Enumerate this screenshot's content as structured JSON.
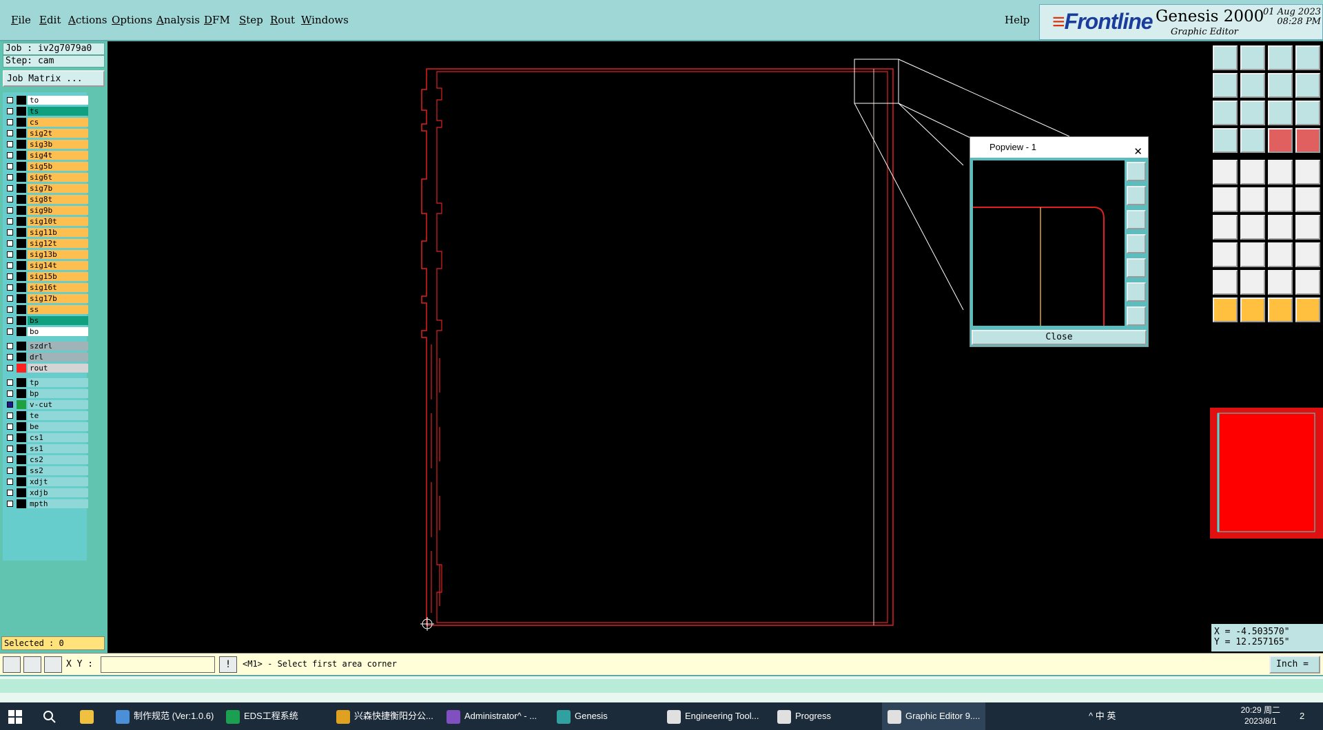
{
  "menubar": {
    "items": [
      "File",
      "Edit",
      "Actions",
      "Options",
      "Analysis",
      "DFM",
      "Step",
      "Rout",
      "Windows"
    ],
    "help": "Help"
  },
  "brand": {
    "logo": "Frontline",
    "product": "Genesis 2000",
    "subtitle": "Graphic Editor",
    "date": "01 Aug 2023",
    "time": "08:28 PM"
  },
  "left_panel": {
    "job": "Job : iv2g7079a0",
    "step": "Step: cam",
    "job_matrix": "Job Matrix ...",
    "selected": "Selected : 0",
    "layers": [
      {
        "name": "to",
        "color": "#ffffff",
        "sw": "#000000"
      },
      {
        "name": "ts",
        "color": "#10a080",
        "sw": "#000000"
      },
      {
        "name": "cs",
        "color": "#ffbe50",
        "sw": "#000000"
      },
      {
        "name": "sig2t",
        "color": "#ffbe50",
        "sw": "#000000"
      },
      {
        "name": "sig3b",
        "color": "#ffbe50",
        "sw": "#000000"
      },
      {
        "name": "sig4t",
        "color": "#ffbe50",
        "sw": "#000000"
      },
      {
        "name": "sig5b",
        "color": "#ffbe50",
        "sw": "#000000"
      },
      {
        "name": "sig6t",
        "color": "#ffbe50",
        "sw": "#000000"
      },
      {
        "name": "sig7b",
        "color": "#ffbe50",
        "sw": "#000000"
      },
      {
        "name": "sig8t",
        "color": "#ffbe50",
        "sw": "#000000"
      },
      {
        "name": "sig9b",
        "color": "#ffbe50",
        "sw": "#000000"
      },
      {
        "name": "sig10t",
        "color": "#ffbe50",
        "sw": "#000000"
      },
      {
        "name": "sig11b",
        "color": "#ffbe50",
        "sw": "#000000"
      },
      {
        "name": "sig12t",
        "color": "#ffbe50",
        "sw": "#000000"
      },
      {
        "name": "sig13b",
        "color": "#ffbe50",
        "sw": "#000000"
      },
      {
        "name": "sig14t",
        "color": "#ffbe50",
        "sw": "#000000"
      },
      {
        "name": "sig15b",
        "color": "#ffbe50",
        "sw": "#000000"
      },
      {
        "name": "sig16t",
        "color": "#ffbe50",
        "sw": "#000000"
      },
      {
        "name": "sig17b",
        "color": "#ffbe50",
        "sw": "#000000"
      },
      {
        "name": "ss",
        "color": "#ffbe50",
        "sw": "#000000"
      },
      {
        "name": "bs",
        "color": "#10a080",
        "sw": "#000000"
      },
      {
        "name": "bo",
        "color": "#ffffff",
        "sw": "#000000"
      },
      {
        "name": "szdrl",
        "color": "#a0b4b8",
        "sw": "#000000",
        "gap": true
      },
      {
        "name": "drl",
        "color": "#a0b4b8",
        "sw": "#000000"
      },
      {
        "name": "rout",
        "color": "#d4d4d4",
        "sw": "#ff2020"
      },
      {
        "name": "tp",
        "color": "#90d8d8",
        "sw": "#000000",
        "gap": true
      },
      {
        "name": "bp",
        "color": "#90d8d8",
        "sw": "#000000"
      },
      {
        "name": "v-cut",
        "color": "#90d8d8",
        "sw": "#20a040",
        "checked": true
      },
      {
        "name": "te",
        "color": "#90d8d8",
        "sw": "#000000"
      },
      {
        "name": "be",
        "color": "#90d8d8",
        "sw": "#000000"
      },
      {
        "name": "cs1",
        "color": "#90d8d8",
        "sw": "#000000"
      },
      {
        "name": "ss1",
        "color": "#90d8d8",
        "sw": "#000000"
      },
      {
        "name": "cs2",
        "color": "#90d8d8",
        "sw": "#000000"
      },
      {
        "name": "ss2",
        "color": "#90d8d8",
        "sw": "#000000"
      },
      {
        "name": "xdjt",
        "color": "#90d8d8",
        "sw": "#000000"
      },
      {
        "name": "xdjb",
        "color": "#90d8d8",
        "sw": "#000000"
      },
      {
        "name": "mpth",
        "color": "#90d8d8",
        "sw": "#000000"
      }
    ]
  },
  "popview": {
    "title": "Popview - 1",
    "close_x": "✕",
    "close_button": "Close"
  },
  "coords": {
    "x": "X = -4.503570\"",
    "y": "Y = 12.257165\""
  },
  "command_bar": {
    "xy_label": "X Y :",
    "xy_value": "",
    "prompt": "<M1> - Select first area corner",
    "unit": "Inch ="
  },
  "taskbar": {
    "items": [
      {
        "label": "制作规范 (Ver:1.0.6)",
        "icon": "#4a8fd8"
      },
      {
        "label": "EDS工程系统",
        "icon": "#1aa050"
      },
      {
        "label": "兴森快捷衡阳分公...",
        "icon": "#e0a020"
      },
      {
        "label": "Administrator^ - ...",
        "icon": "#8050c0"
      },
      {
        "label": "Genesis",
        "icon": "#30a0a0"
      },
      {
        "label": "Engineering Tool...",
        "icon": "#e0e0e0"
      },
      {
        "label": "Progress",
        "icon": "#e0e0e0"
      },
      {
        "label": "Graphic Editor 9....",
        "icon": "#e0e0e0"
      }
    ],
    "tray": "^  中  英",
    "clock_time": "20:29 周二",
    "clock_date": "2023/8/1",
    "notif": "2"
  },
  "colors": {
    "outline": "#e02020",
    "vcut": "#e0d0c0",
    "panel_teal": "#60c4b0"
  }
}
